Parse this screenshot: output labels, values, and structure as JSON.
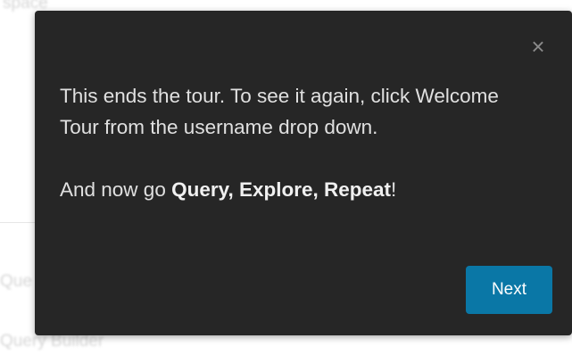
{
  "background": {
    "top_label": "space",
    "item_partial": "Que",
    "item_query_builder": "Query Builder"
  },
  "tour": {
    "close_glyph": "×",
    "line1": "This ends the tour. To see it again, click Welcome Tour from the username drop down.",
    "line2_prefix": "And now go ",
    "line2_bold": "Query, Explore, Repeat",
    "line2_suffix": "!",
    "next_label": "Next"
  },
  "colors": {
    "popover_bg": "#262626",
    "button_bg": "#0a77a6"
  }
}
